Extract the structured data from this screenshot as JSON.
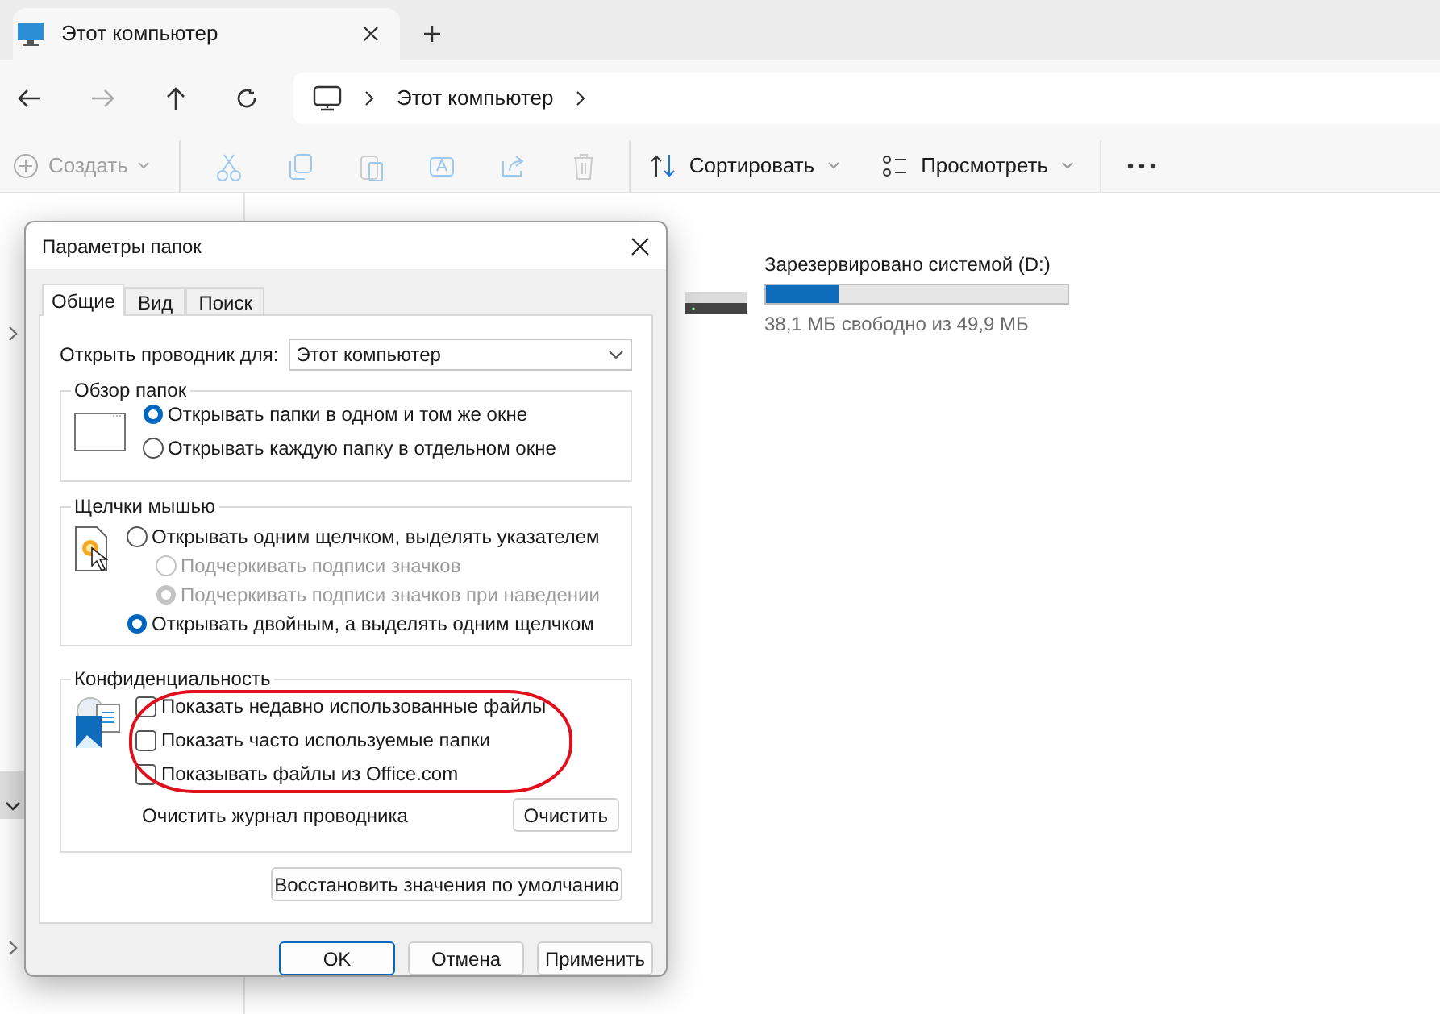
{
  "tabs": [
    {
      "title": "Этот компьютер",
      "selected": true
    }
  ],
  "address": {
    "segments": [
      "Этот компьютер"
    ]
  },
  "toolbar": {
    "create": {
      "label": "Создать",
      "disabled": true
    },
    "sort": {
      "label": "Сортировать"
    },
    "view": {
      "label": "Просмотреть"
    }
  },
  "drive": {
    "name": "Зарезервировано системой (D:)",
    "level": 0.24,
    "free_text": "38,1 МБ свободно из 49,9 МБ"
  },
  "dialog": {
    "title": "Параметры папок",
    "tabs": [
      {
        "label": "Общие",
        "selected": true
      },
      {
        "label": "Вид",
        "selected": false
      },
      {
        "label": "Поиск",
        "selected": false
      }
    ],
    "open_for": {
      "label": "Открыть проводник для:",
      "value": "Этот компьютер"
    },
    "browse": {
      "title": "Обзор папок",
      "options": [
        {
          "label": "Открывать папки в одном и том же окне",
          "selected": true,
          "disabled": false
        },
        {
          "label": "Открывать каждую папку в отдельном окне",
          "selected": false,
          "disabled": false
        }
      ]
    },
    "clicks": {
      "title": "Щелчки мышью",
      "options": [
        {
          "label": "Открывать одним щелчком, выделять указателем",
          "selected": false,
          "disabled": false,
          "children": [
            {
              "label": "Подчеркивать подписи значков",
              "selected": false,
              "disabled": true
            },
            {
              "label": "Подчеркивать подписи значков при наведении",
              "selected": true,
              "disabled": true
            }
          ]
        },
        {
          "label": "Открывать двойным, а выделять одним щелчком",
          "selected": true,
          "disabled": false
        }
      ]
    },
    "privacy": {
      "title": "Конфиденциальность",
      "checkboxes": [
        {
          "label": "Показать недавно использованные файлы",
          "checked": false
        },
        {
          "label": "Показать часто используемые папки",
          "checked": false
        },
        {
          "label": "Показывать файлы из Office.com",
          "checked": false
        }
      ],
      "clear_label": "Очистить журнал проводника",
      "clear_button": "Очистить"
    },
    "restore_button": "Восстановить значения по умолчанию",
    "buttons": [
      {
        "label": "OK",
        "default": true
      },
      {
        "label": "Отмена",
        "default": false
      },
      {
        "label": "Применить",
        "default": false
      }
    ]
  }
}
